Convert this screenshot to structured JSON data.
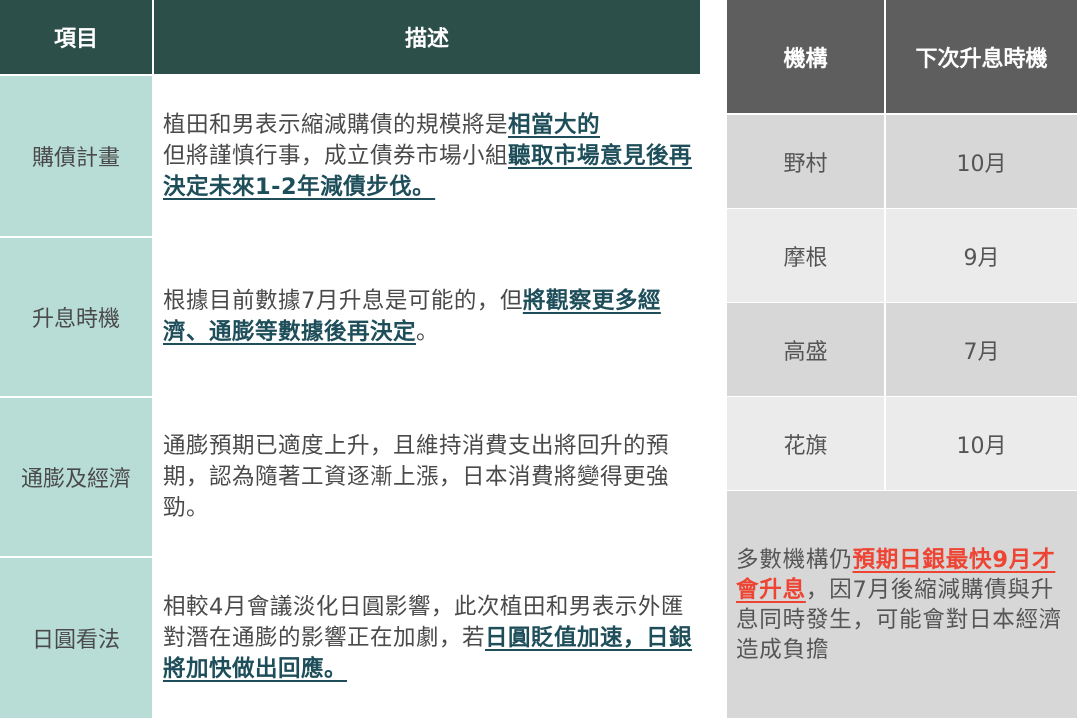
{
  "left_table": {
    "header": {
      "item": "項目",
      "description": "描述"
    },
    "rows": [
      {
        "category": "購債計畫",
        "text_plain": "植田和男表示縮減購債的規模將是",
        "text_hl1": "相當大的",
        "text_mid": "但將謹慎行事，成立債券市場小組",
        "text_hl2": "聽取市場意見後再決定未來1-2年減債步伐。"
      },
      {
        "category": "升息時機",
        "text_plain": "根據目前數據7月升息是可能的，但",
        "text_hl1": "將觀察更多經濟、通膨等數據後再決定",
        "text_end": "。"
      },
      {
        "category": "通膨及經濟",
        "text_plain": "通膨預期已適度上升，且維持消費支出將回升的預期，認為隨著工資逐漸上漲，日本消費將變得更強勁。"
      },
      {
        "category": "日圓看法",
        "text_plain": "相較4月會議淡化日圓影響，此次植田和男表示外匯對潛在通膨的影響正在加劇，若",
        "text_hl1": "日圓貶值加速，日銀將加快做出回應。"
      }
    ]
  },
  "right_table": {
    "header": {
      "org": "機構",
      "next_hike": "下次升息時機"
    },
    "rows": [
      {
        "org": "野村",
        "month": "10月"
      },
      {
        "org": "摩根",
        "month": "9月"
      },
      {
        "org": "高盛",
        "month": "7月"
      },
      {
        "org": "花旗",
        "month": "10月"
      }
    ],
    "note": {
      "before": "多數機構仍",
      "highlight": "預期日銀最快9月才會升息",
      "after": "，因7月後縮減購債與升息同時發生，可能會對日本經濟造成負擔"
    }
  },
  "colors": {
    "left_header_bg": "#2d4f4a",
    "left_category_bg": "#b8dcd6",
    "highlight_text": "#1e4e5a",
    "right_header_bg": "#5e5e5e",
    "right_row_dark": "#d7d7d7",
    "right_row_light": "#ebebeb",
    "note_highlight": "#ee4433"
  }
}
